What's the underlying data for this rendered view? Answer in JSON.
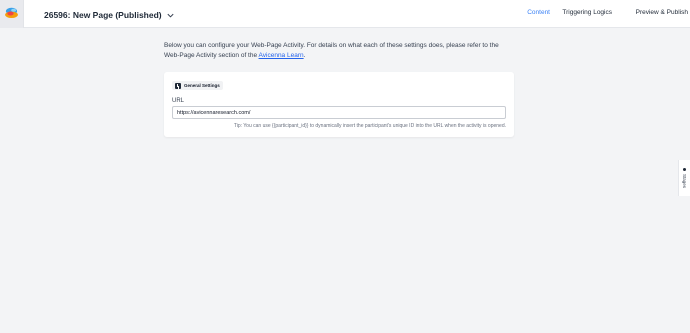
{
  "header": {
    "page_title": "26596: New Page (Published)",
    "nav": [
      {
        "label": "Content",
        "active": true
      },
      {
        "label": "Triggering Logics",
        "active": false
      },
      {
        "label": "Preview & Publish",
        "active": false
      }
    ]
  },
  "intro": {
    "text_before_link": "Below you can configure your Web-Page Activity. For details on what each of these settings does, please refer to the Web-Page Activity section of the ",
    "link_text": "Avicenna Learn",
    "text_after_link": "."
  },
  "general_settings": {
    "section_label": "General Settings",
    "url_label": "URL",
    "url_value": "https://avicennaresearch.com/",
    "tip": "Tip: You can use {{participant_id}} to dynamically insert the participant's unique ID into the URL when the activity is opened."
  },
  "side_tab": {
    "label": "Stages"
  },
  "colors": {
    "accent": "#3b82f6",
    "link": "#2563eb",
    "background": "#f3f4f6"
  },
  "icons": {
    "logo": "avicenna-logo-icon",
    "title_dropdown": "chevron-down-icon",
    "section": "settings-icon",
    "side_tab": "dot-icon"
  }
}
